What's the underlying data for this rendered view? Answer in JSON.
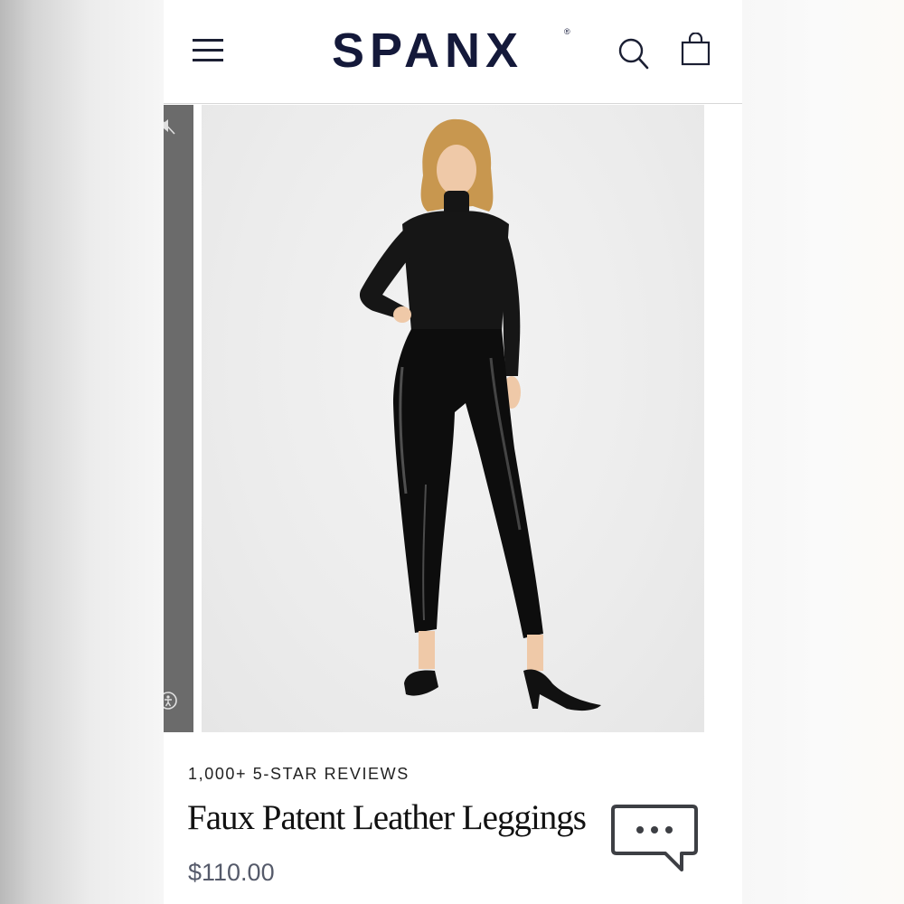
{
  "header": {
    "logo_text": "SPANX",
    "logo_mark": "®",
    "icons": [
      "hamburger-menu-icon",
      "search-icon",
      "shopping-bag-icon"
    ]
  },
  "gallery": {
    "strip_icons": [
      "mute-icon",
      "accessibility-icon"
    ]
  },
  "product": {
    "reviews_label": "1,000+ 5-STAR REVIEWS",
    "title": "Faux Patent Leather Leggings",
    "price": "$110.00"
  },
  "chat": {
    "icon": "chat-bubble-icon"
  },
  "colors": {
    "brand_navy": "#14193a",
    "text_dark": "#111111",
    "price_gray": "#555a6a"
  }
}
